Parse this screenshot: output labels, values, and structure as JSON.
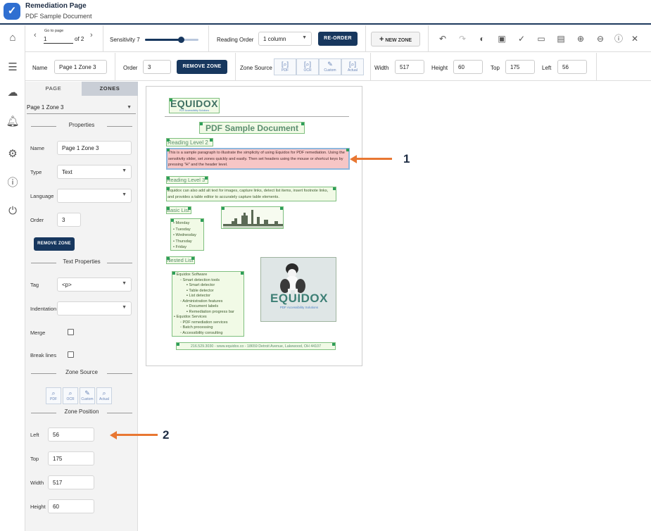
{
  "header": {
    "title": "Remediation Page",
    "subtitle": "PDF Sample Document"
  },
  "rail": {
    "items": [
      "home-icon",
      "list-icon",
      "cloud-upload-icon",
      "bell-icon",
      "gear-icon",
      "help-icon",
      "power-icon"
    ]
  },
  "toolbar": {
    "go_to_page_label": "Go to page",
    "page_value": "1",
    "page_of": "of 2",
    "sensitivity_label": "Sensitivity 7",
    "sensitivity_value": 7,
    "reading_order_label": "Reading Order",
    "reading_order_value": "1 column",
    "reorder_label": "RE-ORDER",
    "new_zone_label": "NEW ZONE"
  },
  "zone_bar": {
    "name_label": "Name",
    "name_value": "Page 1 Zone 3",
    "order_label": "Order",
    "order_value": "3",
    "remove_label": "REMOVE ZONE",
    "zone_source_label": "Zone Source",
    "sources": [
      "PDF",
      "OCR",
      "Custom",
      "Actual"
    ],
    "width_label": "Width",
    "width_value": "517",
    "height_label": "Height",
    "height_value": "60",
    "top_label": "Top",
    "top_value": "175",
    "left_label": "Left",
    "left_value": "56"
  },
  "panel": {
    "tabs": [
      "PAGE",
      "ZONES"
    ],
    "zone_select": "Page 1 Zone 3",
    "properties_title": "Properties",
    "name_label": "Name",
    "name_value": "Page 1 Zone 3",
    "type_label": "Type",
    "type_value": "Text",
    "language_label": "Language",
    "language_value": "",
    "order_label": "Order",
    "order_value": "3",
    "remove_label": "REMOVE ZONE",
    "text_props_title": "Text Properties",
    "tag_label": "Tag",
    "tag_value": "<p>",
    "indent_label": "Indentation",
    "indent_value": "",
    "merge_label": "Merge",
    "break_label": "Break lines",
    "zone_source_title": "Zone Source",
    "sources": [
      "PDF",
      "OCR",
      "Custom",
      "Actual"
    ],
    "zone_pos_title": "Zone Position",
    "left_label": "Left",
    "left_value": "56",
    "top_label": "Top",
    "top_value": "175",
    "width_label": "Width",
    "width_value": "517",
    "height_label": "Height",
    "height_value": "60"
  },
  "document": {
    "logo_text": "EQUIDOX",
    "logo_sub": "PDF Accessibility Solutions",
    "title": "PDF Sample Document",
    "heading2": "Reading Level 2",
    "para1": "This is a sample paragraph to illustrate the simplicity of using Equidox for PDF remediation. Using the sensitivity slider, set zones quickly and easily.  Then set headers using the mouse or shortcut keys by pressing \"H\" and the header level.",
    "heading3": "Reading Level 3",
    "para2": "Equidox can also add alt text for images, capture links, detect list items, insert footnote links, and provides a table editor to accurately capture table elements.",
    "basic_list_heading": "Basic List",
    "basic_list": [
      "Monday",
      "Tuesday",
      "Wednesday",
      "Thursday",
      "Friday"
    ],
    "nested_list_heading": "Nested List",
    "nested_list": [
      {
        "level": 0,
        "text": "Equidox Software"
      },
      {
        "level": 1,
        "text": "Smart detection tools"
      },
      {
        "level": 2,
        "text": "Smart detector"
      },
      {
        "level": 2,
        "text": "Table detector"
      },
      {
        "level": 2,
        "text": "List detector"
      },
      {
        "level": 1,
        "text": "Administration features"
      },
      {
        "level": 2,
        "text": "Document labels"
      },
      {
        "level": 2,
        "text": "Remediation progress bar"
      },
      {
        "level": 0,
        "text": "Equidox Services"
      },
      {
        "level": 1,
        "text": "PDF remediation services"
      },
      {
        "level": 1,
        "text": "Batch processing"
      },
      {
        "level": 1,
        "text": "Accessibility consulting"
      }
    ],
    "image_logo_text": "EQUIDOX",
    "image_logo_sub": "PDF Accessibility Solutions",
    "footer": "216.529.3030 - www.equidox.co - 18659 Detroit Avenue, Lakewood, OH 44107"
  },
  "callouts": [
    "1",
    "2"
  ],
  "colors": {
    "navy": "#17375e",
    "accent": "#2f6fd1",
    "zone_green": "#2e9e5a",
    "selected_zone": "#f7c6c6",
    "arrow": "#e87732"
  }
}
